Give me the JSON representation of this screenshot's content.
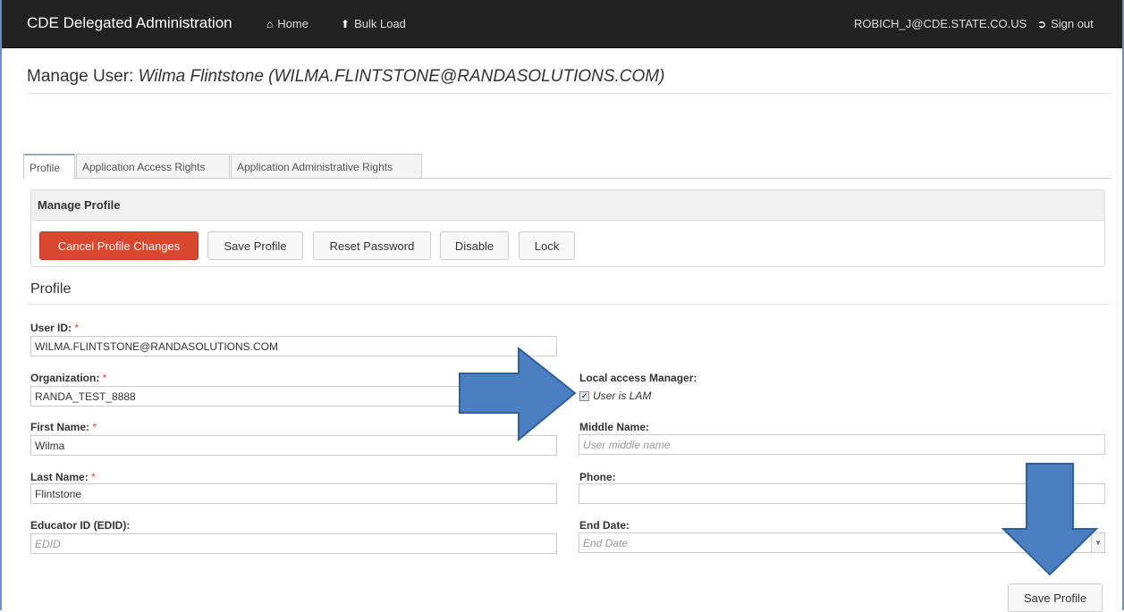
{
  "nav": {
    "brand": "CDE Delegated Administration",
    "home": "Home",
    "bulk_load": "Bulk Load",
    "user": "ROBICH_J@CDE.STATE.CO.US",
    "sign_out": "Sign out"
  },
  "page": {
    "title_prefix": "Manage User:",
    "title_user": "Wilma Flintstone (WILMA.FLINTSTONE@RANDASOLUTIONS.COM)"
  },
  "tabs": [
    "Profile",
    "Application Access Rights",
    "Application Administrative Rights"
  ],
  "panel": {
    "heading": "Manage Profile",
    "buttons": [
      "Cancel Profile Changes",
      "Save Profile",
      "Reset Password",
      "Disable",
      "Lock"
    ]
  },
  "section_title": "Profile",
  "fields": {
    "user_id": {
      "label": "User ID:",
      "value": "WILMA.FLINTSTONE@RANDASOLUTIONS.COM"
    },
    "organization": {
      "label": "Organization:",
      "value": "RANDA_TEST_8888"
    },
    "first_name": {
      "label": "First Name:",
      "value": "Wilma"
    },
    "last_name": {
      "label": "Last Name:",
      "value": "Flintstone"
    },
    "edid": {
      "label": "Educator ID (EDID):",
      "placeholder": "EDID"
    },
    "lam": {
      "label": "Local access Manager:",
      "checkbox_label": "User is LAM",
      "checked": true
    },
    "middle_name": {
      "label": "Middle Name:",
      "placeholder": "User middle name"
    },
    "phone": {
      "label": "Phone:",
      "value": ""
    },
    "end_date": {
      "label": "End Date:",
      "placeholder": "End Date"
    }
  },
  "required_marker": "*",
  "save_button": "Save Profile",
  "colors": {
    "navbar": "#222222",
    "danger": "#d9472f",
    "arrow": "#4a7fc1"
  }
}
